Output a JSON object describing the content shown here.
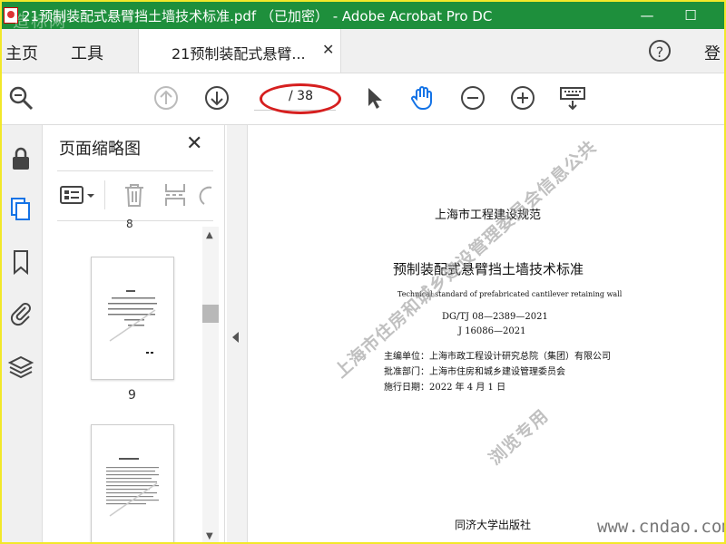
{
  "window": {
    "title": "21预制装配式悬臂挡土墙技术标准.pdf （已加密） - Adobe Acrobat Pro DC",
    "minimize": "—",
    "maximize": "☐",
    "watermark": "造标网"
  },
  "menu": {
    "home": "主页",
    "tools": "工具",
    "tab_label": "21预制装配式悬臂...",
    "tab_close": "✕",
    "help": "?",
    "login": "登"
  },
  "toolbar": {
    "current_page": "",
    "total_pages": "/ 38",
    "icons": [
      "search-icon",
      "page-up-icon",
      "page-down-icon",
      "select-cursor-icon",
      "hand-tool-icon",
      "zoom-out-icon",
      "zoom-in-icon",
      "keyboard-scroll-icon"
    ]
  },
  "thumbnails": {
    "title": "页面缩略图",
    "close": "✕",
    "prev_label": "8",
    "page_label": "9"
  },
  "document": {
    "header": "上海市工程建设规范",
    "title": "预制装配式悬臂挡土墙技术标准",
    "subtitle_en": "Technical standard of prefabricated cantilever retaining wall",
    "code1": "DG/TJ 08—2389—2021",
    "code2": "J 16086—2021",
    "editor": "主编单位：上海市政工程设计研究总院（集团）有限公司",
    "approver": "批准部门：上海市住房和城乡建设管理委员会",
    "date": "施行日期：2022 年 4 月 1 日",
    "publisher": "同济大学出版社",
    "stamp_line1": "上海市住房和城乡建设管理委员会信息公共",
    "stamp_line2": "浏览专用",
    "site_watermark": "www.cndao.com"
  },
  "colors": {
    "titlebar": "#1e8f3c",
    "border": "#f2e82a",
    "annotation": "#d61f1f",
    "accent_blue": "#1473e6"
  }
}
